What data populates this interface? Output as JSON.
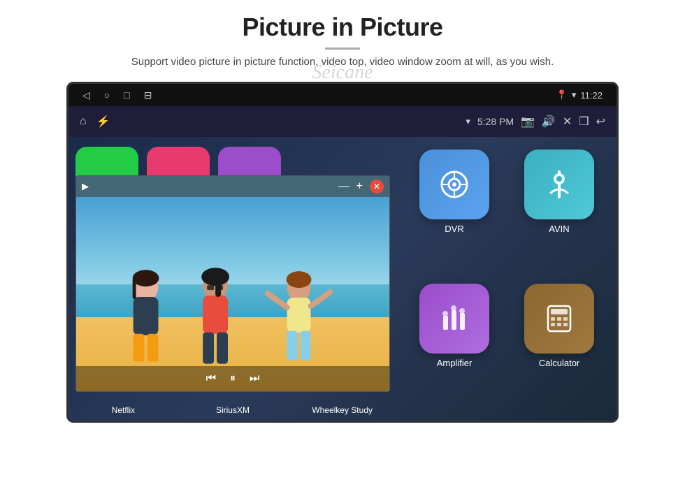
{
  "page": {
    "title": "Picture in Picture",
    "subtitle": "Support video picture in picture function, video top, video window zoom at will, as you wish.",
    "watermark": "Seicane"
  },
  "device": {
    "status_bar": {
      "time": "11:22",
      "nav_back": "◁",
      "nav_home": "○",
      "nav_recent": "□",
      "nav_extra": "⊟"
    },
    "action_bar": {
      "home_icon": "⌂",
      "usb_icon": "🔌",
      "wifi": "▾",
      "time": "5:28 PM",
      "camera_icon": "📷",
      "sound_icon": "🔊",
      "close_icon": "✕",
      "window_icon": "❒",
      "back_icon": "↩"
    }
  },
  "pip": {
    "play_icon": "▶",
    "rewind_icon": "⏮",
    "forward_icon": "⏭",
    "minimize_icon": "—",
    "maximize_icon": "+",
    "close_icon": "✕"
  },
  "apps": {
    "top_partial": [
      {
        "id": "netflix",
        "color": "green",
        "label": "Netflix"
      },
      {
        "id": "siriusxm",
        "color": "pink",
        "label": "SiriusXM"
      },
      {
        "id": "wheelkey",
        "color": "purple",
        "label": "Wheelkey Study"
      }
    ],
    "right": [
      {
        "id": "dvr",
        "label": "DVR",
        "icon_type": "dvr"
      },
      {
        "id": "avin",
        "label": "AVIN",
        "icon_type": "avin"
      },
      {
        "id": "amplifier",
        "label": "Amplifier",
        "icon_type": "amplifier"
      },
      {
        "id": "calculator",
        "label": "Calculator",
        "icon_type": "calculator"
      }
    ]
  }
}
